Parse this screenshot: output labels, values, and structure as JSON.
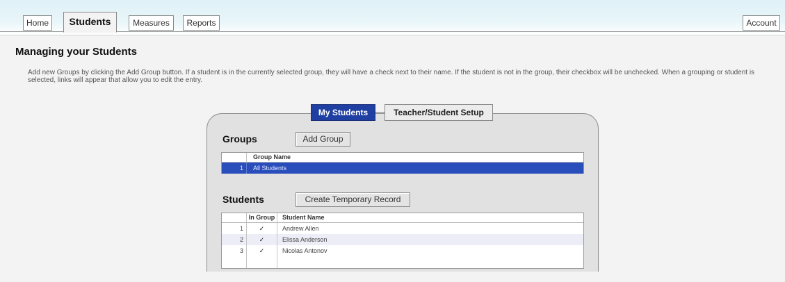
{
  "nav": {
    "tabs": [
      {
        "label": "Home"
      },
      {
        "label": "Students"
      },
      {
        "label": "Measures"
      },
      {
        "label": "Reports"
      }
    ],
    "account_label": "Account"
  },
  "page": {
    "title": "Managing your Students",
    "intro": "Add new Groups by clicking the Add Group button. If a student is in the currently selected group, they will have a check next to their name. If the student is not in the group, their checkbox will be unchecked. When a grouping or student is selected, links will appear that allow you to edit the entry."
  },
  "panel_tabs": {
    "active": "My Students",
    "inactive": "Teacher/Student Setup"
  },
  "groups": {
    "label": "Groups",
    "add_button": "Add Group",
    "column_header": "Group Name",
    "rows": [
      {
        "num": "1",
        "name": "All Students",
        "selected": true
      }
    ]
  },
  "students": {
    "label": "Students",
    "create_button": "Create Temporary Record",
    "columns": {
      "in_group": "In Group",
      "name": "Student Name"
    },
    "rows": [
      {
        "num": "1",
        "check": "✓",
        "name": "Andrew Allen"
      },
      {
        "num": "2",
        "check": "✓",
        "name": "Elissa Anderson"
      },
      {
        "num": "3",
        "check": "✓",
        "name": "Nicolas Antonov"
      }
    ]
  },
  "colors": {
    "active_tab": "#1f3fa3",
    "selected_row": "#2a4dbc",
    "alt_row": "#ecedf6"
  }
}
